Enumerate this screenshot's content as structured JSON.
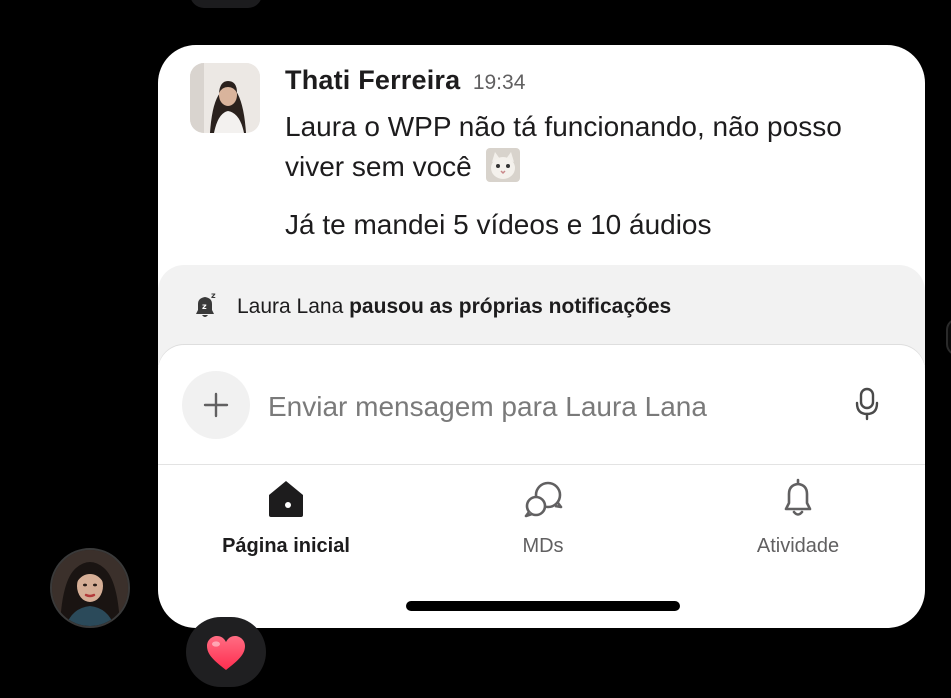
{
  "message": {
    "sender_name": "Thati Ferreira",
    "time": "19:34",
    "text_line1": "Laura o WPP não tá funcionando, não posso viver sem você",
    "emoji": "cat-emoji",
    "text_line2": "Já te mandei 5 vídeos e 10 áudios"
  },
  "notification": {
    "user": "Laura Lana",
    "action": "pausou as próprias notificações",
    "icon": "bell-snooze-icon"
  },
  "composer": {
    "placeholder": "Enviar mensagem para Laura Lana",
    "add_icon": "plus-icon",
    "mic_icon": "microphone-icon"
  },
  "tabs": [
    {
      "label": "Página inicial",
      "icon": "home-icon",
      "active": true
    },
    {
      "label": "MDs",
      "icon": "chat-bubbles-icon",
      "active": false
    },
    {
      "label": "Atividade",
      "icon": "bell-icon",
      "active": false
    }
  ],
  "reaction": {
    "icon": "heart-icon"
  },
  "colors": {
    "background": "#000000",
    "card": "#ffffff",
    "text": "#1d1c1d",
    "muted": "#616061",
    "notif_bar": "#f2f2f2",
    "heart": "#ff3b5c"
  }
}
